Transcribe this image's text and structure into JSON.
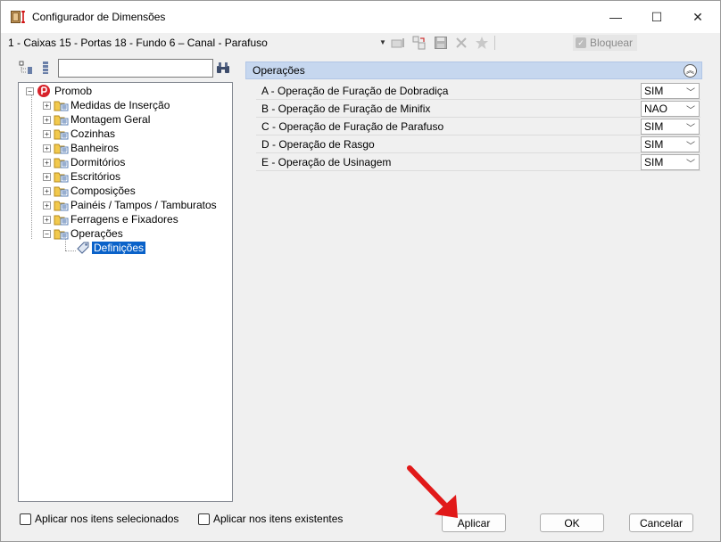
{
  "window": {
    "title": "Configurador de Dimensões",
    "controls": {
      "minimize": "—",
      "maximize": "☐",
      "close": "✕"
    }
  },
  "configbar": {
    "selected_config": "1 - Caixas 15 - Portas 18 - Fundo 6 – Canal - Parafuso",
    "lock_label": "Bloquear",
    "lock_checked": true
  },
  "tree": {
    "search_value": "",
    "root": "Promob",
    "items": [
      {
        "label": "Medidas de Inserção",
        "expander": "+"
      },
      {
        "label": "Montagem Geral",
        "expander": "+"
      },
      {
        "label": "Cozinhas",
        "expander": "+"
      },
      {
        "label": "Banheiros",
        "expander": "+"
      },
      {
        "label": "Dormitórios",
        "expander": "+"
      },
      {
        "label": "Escritórios",
        "expander": "+"
      },
      {
        "label": "Composições",
        "expander": "+"
      },
      {
        "label": "Painéis / Tampos / Tamburatos",
        "expander": "+"
      },
      {
        "label": "Ferragens e Fixadores",
        "expander": "+"
      },
      {
        "label": "Operações",
        "expander": "−"
      }
    ],
    "selected_child": "Definições"
  },
  "section": {
    "title": "Operações",
    "rows": [
      {
        "label": "A - Operação de Furação de Dobradiça",
        "value": "SIM"
      },
      {
        "label": "B - Operação de Furação de Minifix",
        "value": "NAO"
      },
      {
        "label": "C - Operação de Furação de Parafuso",
        "value": "SIM"
      },
      {
        "label": "D - Operação de Rasgo",
        "value": "SIM"
      },
      {
        "label": "E - Operação de Usinagem",
        "value": "SIM"
      }
    ]
  },
  "footer": {
    "apply_selected_label": "Aplicar nos itens selecionados",
    "apply_existing_label": "Aplicar nos itens existentes",
    "apply_button": "Aplicar",
    "ok_button": "OK",
    "cancel_button": "Cancelar"
  },
  "colors": {
    "section_header": "#c6d7ef",
    "selection": "#0a62c9",
    "arrow": "#e11919"
  }
}
